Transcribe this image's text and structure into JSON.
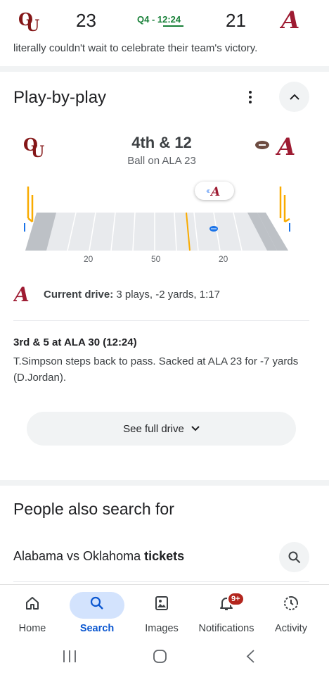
{
  "scorebar": {
    "home_logo": "OU",
    "home_score": "23",
    "clock": "Q4 - 12:24",
    "away_score": "21",
    "away_logo": "A"
  },
  "snippet": "literally couldn't wait to celebrate their team's victory.",
  "play_by_play": {
    "title": "Play-by-play",
    "more_icon": "more-vert-icon",
    "collapse_icon": "chevron-up-icon",
    "down_distance": "4th & 12",
    "ball_on": "Ball on ALA 23",
    "yard_labels": [
      "20",
      "50",
      "20"
    ],
    "current_drive_label": "Current drive:",
    "current_drive_value": " 3 plays, -2 yards, 1:17",
    "last_play_title": "3rd & 5 at ALA 30 (12:24)",
    "last_play_desc": "T.Simpson steps back to pass. Sacked at ALA 23 for -7 yards (D.Jordan).",
    "see_full_drive": "See full drive"
  },
  "people_also_search": {
    "title": "People also search for",
    "item_prefix": "Alabama vs Oklahoma ",
    "item_bold": "tickets"
  },
  "bottom_nav": {
    "items": [
      {
        "label": "Home",
        "icon": "home-icon"
      },
      {
        "label": "Search",
        "icon": "search-icon"
      },
      {
        "label": "Images",
        "icon": "images-icon"
      },
      {
        "label": "Notifications",
        "icon": "bell-icon"
      },
      {
        "label": "Activity",
        "icon": "activity-icon"
      }
    ],
    "active": "Search",
    "notification_badge": "9+"
  },
  "colors": {
    "ou": "#841617",
    "alabama": "#9e1b32",
    "clock_green": "#188038",
    "active_blue": "#0b57d0"
  }
}
